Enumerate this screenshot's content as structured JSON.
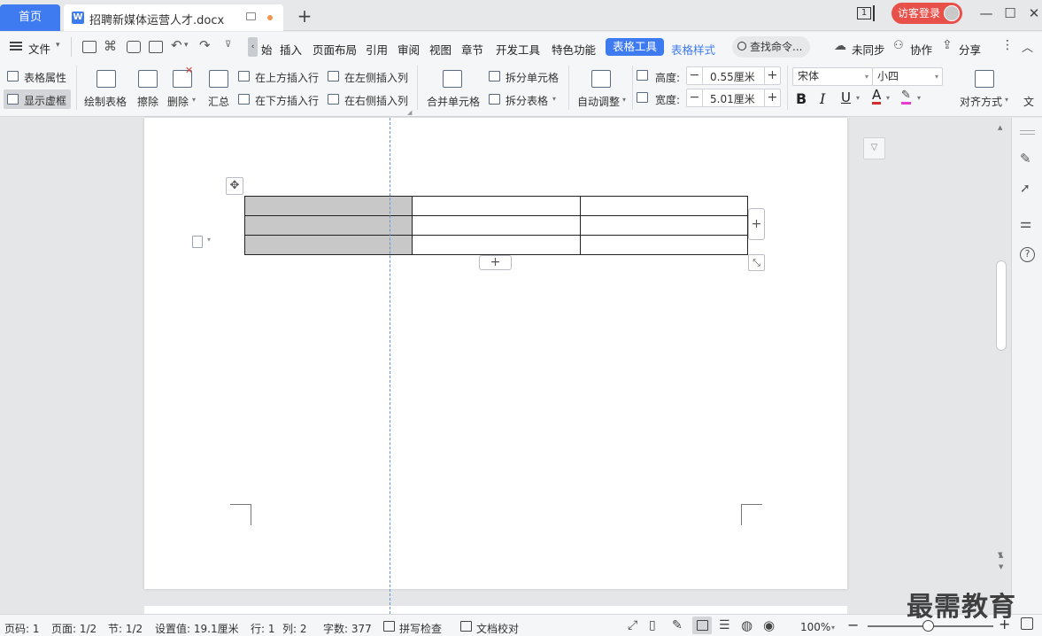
{
  "tabs": {
    "home": "首页",
    "document": "招聘新媒体运营人才.docx",
    "new_tab": "+"
  },
  "window": {
    "page_indicator": "1",
    "login": "访客登录",
    "minimize": "—",
    "maximize": "☐",
    "close": "✕"
  },
  "menu": {
    "file": "文件",
    "items": [
      "始",
      "插入",
      "页面布局",
      "引用",
      "审阅",
      "视图",
      "章节",
      "开发工具",
      "特色功能"
    ],
    "table_tools": "表格工具",
    "table_style": "表格样式",
    "search": "查找命令...",
    "sync": "未同步",
    "collab": "协作",
    "share": "分享"
  },
  "ribbon": {
    "table_props": "表格属性",
    "show_gridlines": "显示虚框",
    "draw_table": "绘制表格",
    "erase": "擦除",
    "delete": "删除",
    "summary": "汇总",
    "insert_row_above": "在上方插入行",
    "insert_row_below": "在下方插入行",
    "insert_col_left": "在左侧插入列",
    "insert_col_right": "在右侧插入列",
    "merge_cells": "合并单元格",
    "split_cells": "拆分单元格",
    "split_table": "拆分表格",
    "auto_fit": "自动调整",
    "height_label": "高度:",
    "height_value": "0.55厘米",
    "width_label": "宽度:",
    "width_value": "5.01厘米",
    "font_name": "宋体",
    "font_size": "小四",
    "bold": "B",
    "italic": "I",
    "underline": "U",
    "font_color": "A",
    "align": "对齐方式",
    "text_dir": "文"
  },
  "table": {
    "rows": 3,
    "cols": 3,
    "selected_column": 0,
    "selected_fill": "#c8c8c8"
  },
  "status": {
    "page_no": "页码: 1",
    "pages": "页面: 1/2",
    "section": "节: 1/2",
    "setting": "设置值: 19.1厘米",
    "row": "行: 1",
    "col": "列: 2",
    "words": "字数: 377",
    "spell": "拼写检查",
    "proof": "文档校对",
    "zoom": "100%"
  },
  "watermark": "最需教育",
  "colors": {
    "accent": "#3e7af0",
    "login_red": "#e8504a",
    "unsaved_dot": "#f09550"
  }
}
